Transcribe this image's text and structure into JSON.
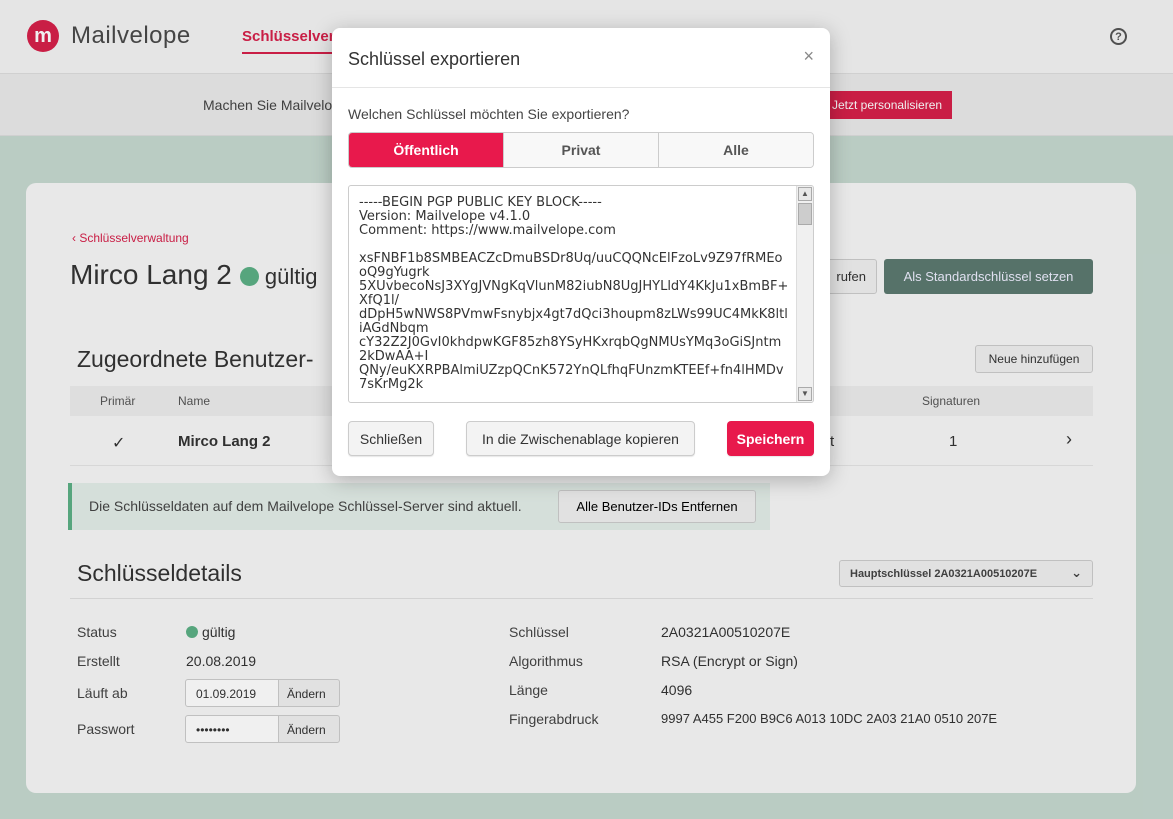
{
  "header": {
    "logo_glyph": "m",
    "app_name": "Mailvelope",
    "nav_active": "Schlüsselver",
    "help_glyph": "?"
  },
  "banner": {
    "text": "Machen Sie Mailvelo",
    "button": "Jetzt personalisieren"
  },
  "page": {
    "back_link": "‹ Schlüsselverwaltung",
    "title": "Mirco Lang 2",
    "title_status": "gültig",
    "retrieve_button": "rufen",
    "default_key_button": "Als Standardschlüssel setzen"
  },
  "userids": {
    "title": "Zugeordnete Benutzer-",
    "add_button": "Neue hinzufügen",
    "columns": [
      "Primär",
      "Name",
      "Signaturen"
    ],
    "rows": [
      {
        "primary": "✓",
        "name": "Mirco Lang 2",
        "t": "t",
        "signatures": "1",
        "arrow": "›"
      }
    ]
  },
  "info": {
    "text": "Die Schlüsseldaten auf dem Mailvelope Schlüssel-Server sind aktuell.",
    "remove_button": "Alle Benutzer-IDs Entfernen"
  },
  "details": {
    "title": "Schlüsseldetails",
    "key_select": "Hauptschlüssel 2A0321A00510207E",
    "chevron": "⌄",
    "status_label": "Status",
    "status_value": "gültig",
    "created_label": "Erstellt",
    "created_value": "20.08.2019",
    "expires_label": "Läuft ab",
    "expires_value": "01.09.2019",
    "change_label": "Ändern",
    "password_label": "Passwort",
    "password_value": "••••••••",
    "key_label": "Schlüssel",
    "key_value": "2A0321A00510207E",
    "algo_label": "Algorithmus",
    "algo_value": "RSA (Encrypt or Sign)",
    "length_label": "Länge",
    "length_value": "4096",
    "fingerprint_label": "Fingerabdruck",
    "fingerprint_value": "9997 A455 F200 B9C6 A013 10DC 2A03 21A0 0510 207E"
  },
  "modal": {
    "title": "Schlüssel exportieren",
    "close": "×",
    "question": "Welchen Schlüssel möchten Sie exportieren?",
    "tabs": [
      "Öffentlich",
      "Privat",
      "Alle"
    ],
    "key_text": "-----BEGIN PGP PUBLIC KEY BLOCK-----\nVersion: Mailvelope v4.1.0\nComment: https://www.mailvelope.com\n\nxsFNBF1b8SMBEACZcDmuBSDr8Uq/uuCQQNcElFzoLv9Z97fRMEooQ9gYugrk\n5XUvbecoNsJ3XYgJVNgKqVlunM82iubN8UgJHYLldY4KkJu1xBmBF+XfQ1l/\ndDpH5wNWS8PVmwFsnybjx4gt7dQci3houpm8zLWs99UC4MkK8ltliAGdNbqm\ncY32Z2J0GvI0khdpwKGF85zh8YSyHKxrqbQgNMUsYMq3oGiSJntm2kDwAA+I\nQNy/euKXRPBAlmiUZzpQCnK572YnQLfhqFUnzmKTEEf+fn4lHMDv7sKrMg2k",
    "scroll_up": "▲",
    "scroll_down": "▼",
    "close_button": "Schließen",
    "copy_button": "In die Zwischenablage kopieren",
    "save_button": "Speichern"
  },
  "colors": {
    "brand": "#d6204a",
    "accent_button": "#e8194c",
    "success": "#5cb085",
    "default_btn": "#5c7a70"
  }
}
